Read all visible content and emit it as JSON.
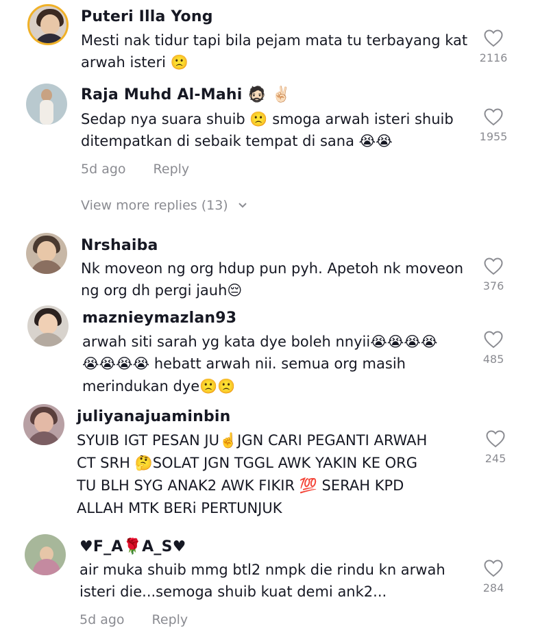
{
  "comments": [
    {
      "username": "Puteri Illa Yong",
      "lines": [
        "Mesti nak tidur tapi bila pejam mata tu terbayang kat",
        "arwah isteri 🙁"
      ],
      "likes": "2116"
    },
    {
      "username": "Raja Muhd Al-Mahi 🧔🏻 ✌🏻",
      "lines": [
        "Sedap nya suara shuib 🙁 smoga arwah isteri shuib",
        "ditempatkan di sebaik tempat di sana 😭😭"
      ],
      "likes": "1955",
      "time": "5d ago",
      "reply": "Reply",
      "view_more": "View more replies (13)"
    },
    {
      "username": "Nrshaiba",
      "lines": [
        "Nk moveon ng org hdup pun pyh. Apetoh nk moveon",
        "ng org dh pergi jauh😔"
      ],
      "likes": "376"
    },
    {
      "username": "maznieymazlan93",
      "lines": [
        "arwah siti sarah yg kata dye boleh nnyii😭😭😭😭",
        "😭😭😭😭 hebatt arwah nii. semua org masih",
        "merindukan dye🙁🙁"
      ],
      "likes": "485"
    },
    {
      "username": "juliyanajuaminbin",
      "lines": [
        "SYUIB IGT PESAN JU☝️JGN CARI PEGANTI ARWAH",
        "CT SRH 🤔SOLAT JGN TGGL AWK YAKIN KE ORG",
        "TU BLH SYG ANAK2 AWK FIKIR 💯 SERAH KPD",
        "ALLAH MTK BERi PERTUNJUK"
      ],
      "likes": "245"
    },
    {
      "username": "♥F_A🌹A_S♥",
      "lines": [
        "air muka shuib mmg btl2 nmpk die rindu kn arwah",
        "isteri die...semoga shuib kuat demi ank2..."
      ],
      "likes": "284",
      "time": "5d ago",
      "reply": "Reply"
    }
  ],
  "colors": {
    "text": "#161823",
    "muted": "#8a8b91",
    "avatar_ring": "#f0b128"
  },
  "icons": {
    "like": "heart-outline-icon",
    "expand": "chevron-down-icon"
  }
}
